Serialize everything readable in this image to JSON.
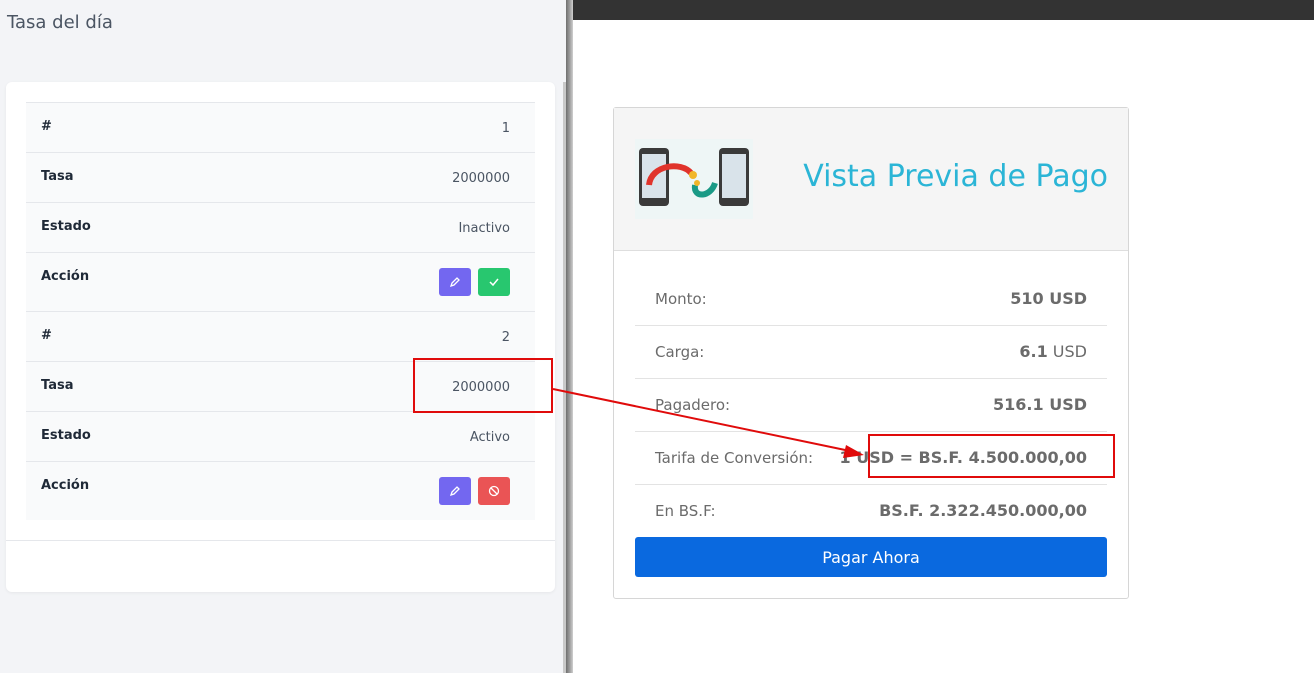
{
  "left_panel": {
    "title": "Tasa del día",
    "records": [
      {
        "num_label": "#",
        "num": "1",
        "rate_label": "Tasa",
        "rate": "2000000",
        "status_label": "Estado",
        "status": "Inactivo",
        "action_label": "Acción"
      },
      {
        "num_label": "#",
        "num": "2",
        "rate_label": "Tasa",
        "rate": "2000000",
        "status_label": "Estado",
        "status": "Activo",
        "action_label": "Acción"
      }
    ]
  },
  "payment_preview": {
    "title": "Vista Previa de Pago",
    "rows": [
      {
        "label": "Monto:",
        "value_bold": "510 USD",
        "value_rest": ""
      },
      {
        "label": "Carga:",
        "value_bold": "6.1",
        "value_rest": " USD"
      },
      {
        "label": "Pagadero:",
        "value_bold": "516.1 USD",
        "value_rest": ""
      },
      {
        "label": "Tarifa de Conversión:",
        "value_bold": "1 USD = BS.F. 4.500.000,00",
        "value_rest": ""
      },
      {
        "label": "En BS.F:",
        "value_bold": "BS.F. 2.322.450.000,00",
        "value_rest": ""
      }
    ],
    "pay_button": "Pagar Ahora"
  },
  "colors": {
    "accent_title": "#2bb5d6",
    "pay_button": "#0a69df",
    "edit_button": "#7367f0",
    "activate_button": "#28c76f",
    "deactivate_button": "#ea5455",
    "annotation": "#e00b0b"
  },
  "icons": {
    "edit": "pencil-icon",
    "activate": "check-icon",
    "deactivate": "ban-icon",
    "logo": "phones-money-transfer-logo"
  }
}
